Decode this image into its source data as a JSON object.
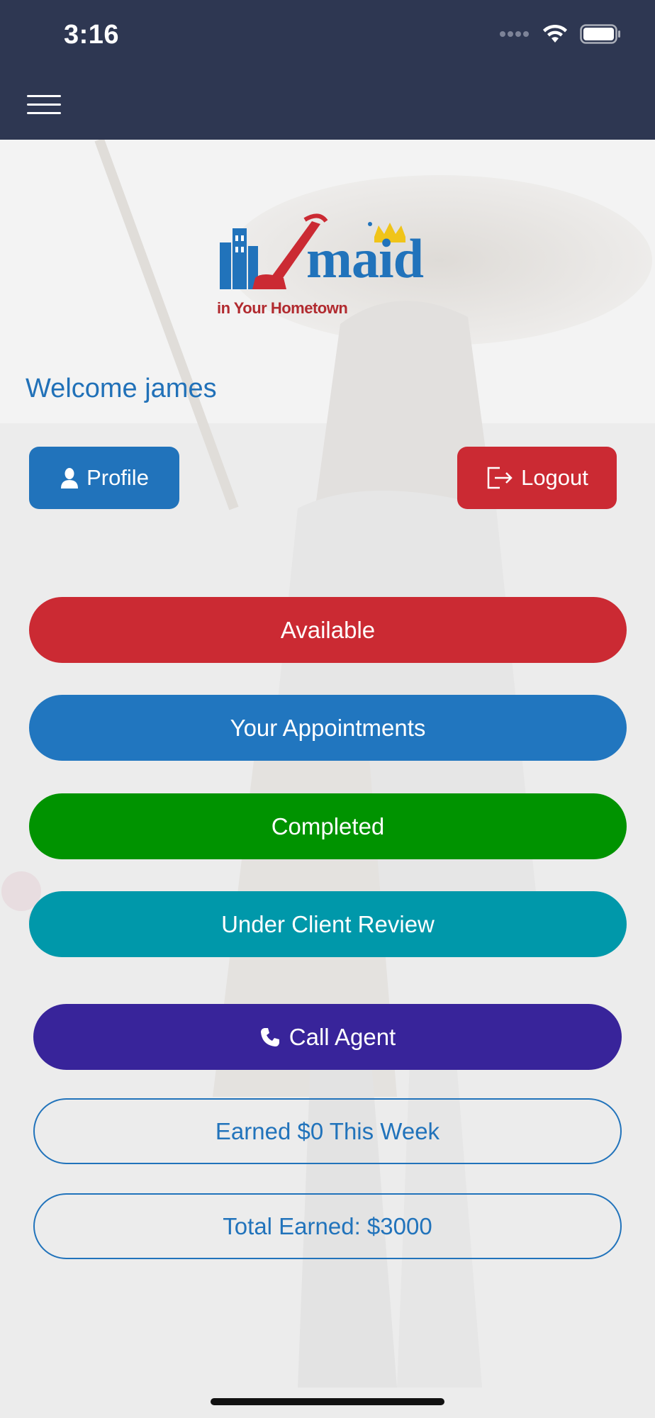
{
  "status_bar": {
    "time": "3:16",
    "icons": [
      "signal-icon",
      "wifi-icon",
      "battery-icon"
    ]
  },
  "nav": {
    "menu_icon": "hamburger-menu-icon"
  },
  "logo": {
    "wordmark": "maid",
    "tagline": "in Your Hometown"
  },
  "welcome": "Welcome james",
  "buttons": {
    "profile": {
      "label": "Profile",
      "icon": "user-icon"
    },
    "logout": {
      "label": "Logout",
      "icon": "logout-icon"
    }
  },
  "actions": {
    "available": "Available",
    "appointments": "Your Appointments",
    "completed": "Completed",
    "under_review": "Under Client Review",
    "call_agent": {
      "label": "Call Agent",
      "icon": "phone-icon"
    },
    "earned_week": "Earned $0 This Week",
    "total_earned": "Total Earned: $3000"
  },
  "colors": {
    "header": "#2e3752",
    "blue": "#2173bb",
    "red": "#cb2a33",
    "green": "#009300",
    "teal": "#0098aa",
    "purple": "#38249a"
  }
}
